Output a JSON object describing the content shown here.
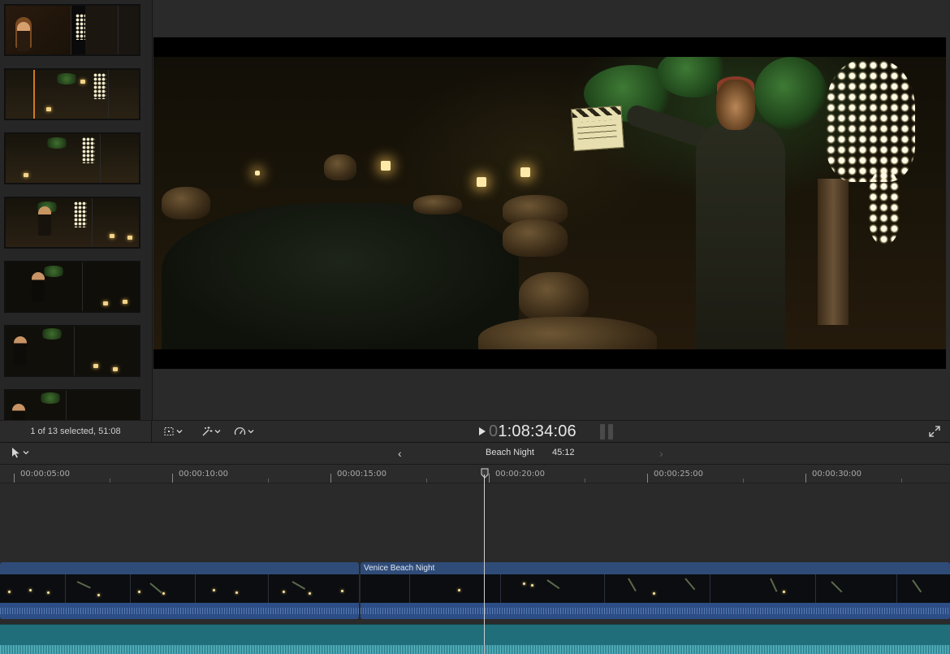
{
  "browser": {
    "status_text": "1 of 13 selected, 51:08",
    "filmstrips": [
      "clip-1",
      "clip-2",
      "clip-3",
      "clip-4",
      "clip-5",
      "clip-6",
      "clip-7"
    ]
  },
  "viewer": {
    "timecode_dim": "0",
    "timecode": "1:08:34:06",
    "icons": {
      "transform": "crop-icon",
      "tools": "magic-wand-icon",
      "speed": "speedometer-icon",
      "play": "play-icon",
      "fullscreen": "fullscreen-icon"
    }
  },
  "timeline_header": {
    "project_name": "Beach Night",
    "project_duration": "45:12",
    "back_arrow": "‹",
    "forward_arrow": "›"
  },
  "ruler": {
    "labels": [
      "00:00:05:00",
      "00:00:10:00",
      "00:00:15:00",
      "00:00:20:00",
      "00:00:25:00",
      "00:00:30:00"
    ]
  },
  "clips": {
    "primary_title": "Venice Beach Night"
  },
  "colors": {
    "clip_blue": "#2f4b78",
    "audio_teal": "#1f6e7a",
    "selection_orange": "#d07a1f"
  }
}
